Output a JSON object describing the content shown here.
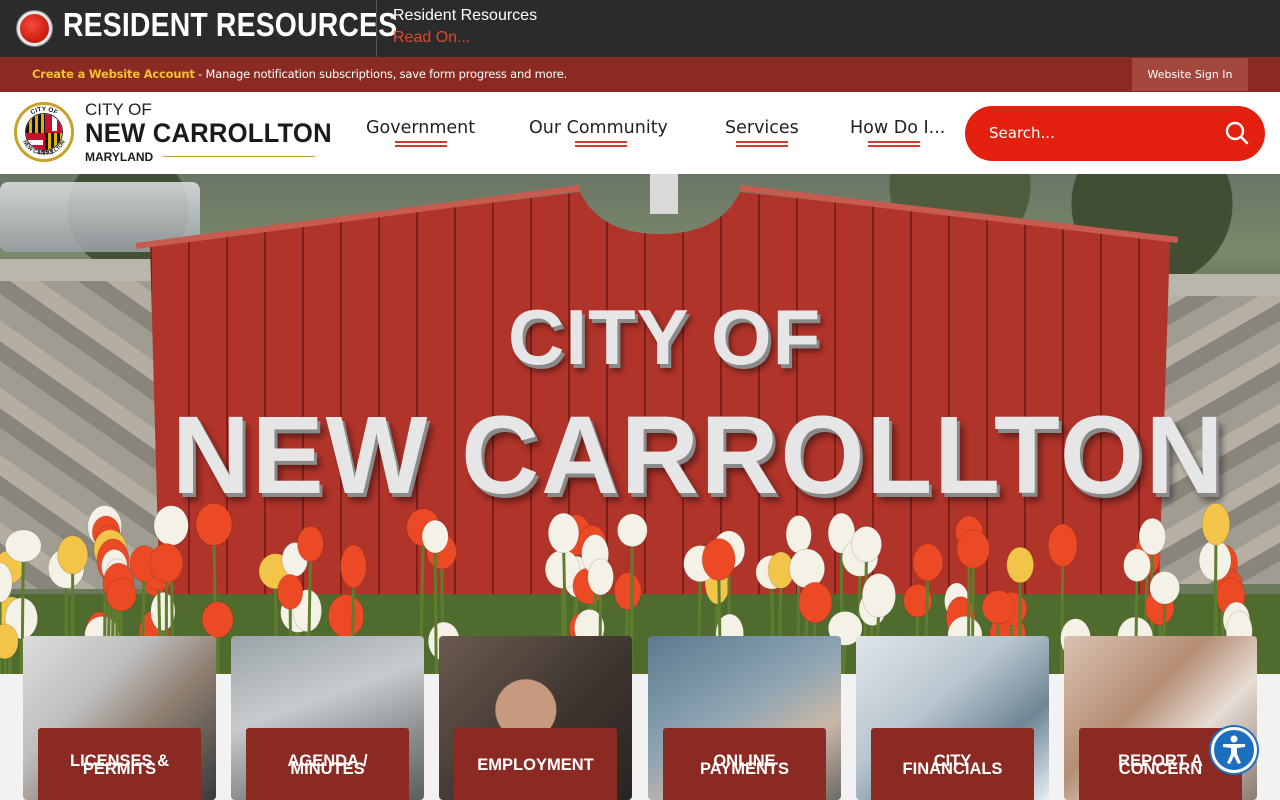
{
  "alert": {
    "title": "RESIDENT RESOURCES",
    "item_title": "Resident Resources",
    "read_on": "Read On..."
  },
  "account_bar": {
    "create_link": "Create a Website Account",
    "message": " - Manage notification subscriptions, save form progress and more.",
    "sign_in": "Website Sign In"
  },
  "logo": {
    "line1": "CITY OF",
    "line2": "NEW CARROLLTON",
    "line3": "MARYLAND",
    "seal_top": "CITY OF",
    "seal_bottom": "NEW CARROLLTON",
    "seal_year": "1953"
  },
  "nav": {
    "items": [
      {
        "label": "Government"
      },
      {
        "label": "Our Community"
      },
      {
        "label": "Services"
      },
      {
        "label": "How Do I..."
      }
    ]
  },
  "search": {
    "placeholder": "Search..."
  },
  "hero": {
    "sign_line1": "CITY OF",
    "sign_line2": "NEW CARROLLTON"
  },
  "quick_links": [
    {
      "label_line1": "LICENSES &",
      "label_line2": "PERMITS"
    },
    {
      "label_line1": "AGENDA /",
      "label_line2": "MINUTES"
    },
    {
      "label_line1": "EMPLOYMENT",
      "label_line2": ""
    },
    {
      "label_line1": "ONLINE",
      "label_line2": "PAYMENTS"
    },
    {
      "label_line1": "CITY",
      "label_line2": "FINANCIALS"
    },
    {
      "label_line1": "REPORT A",
      "label_line2": "CONCERN"
    }
  ],
  "colors": {
    "alert_bg": "#2b2b2b",
    "account_bar_bg": "#8b2a22",
    "accent_red": "#e3200f",
    "read_on": "#e0472b",
    "create_link": "#f2c230",
    "quick_link_bg": "#8b2a22",
    "accessibility_blue": "#1c6fbf"
  },
  "icons": {
    "alert": "alert-dot-icon",
    "search": "search-icon",
    "accessibility": "accessibility-icon"
  }
}
